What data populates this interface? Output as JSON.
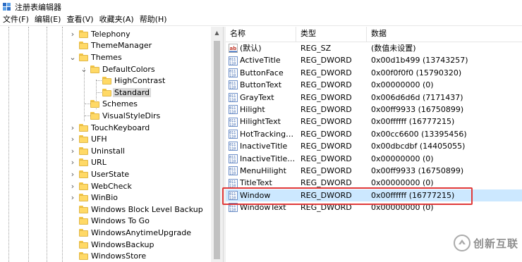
{
  "window": {
    "title": "注册表编辑器"
  },
  "menu": [
    "文件(F)",
    "编辑(E)",
    "查看(V)",
    "收藏夹(A)",
    "帮助(H)"
  ],
  "tree": {
    "items": [
      {
        "label": "Telephony",
        "expanded": false
      },
      {
        "label": "ThemeManager",
        "expanded": null
      },
      {
        "label": "Themes",
        "expanded": true
      },
      {
        "label": "DefaultColors",
        "expanded": true
      },
      {
        "label": "HighContrast",
        "expanded": null
      },
      {
        "label": "Standard",
        "expanded": null,
        "selected": true
      },
      {
        "label": "Schemes",
        "expanded": null
      },
      {
        "label": "VisualStyleDirs",
        "expanded": null
      },
      {
        "label": "TouchKeyboard",
        "expanded": false
      },
      {
        "label": "UFH",
        "expanded": false
      },
      {
        "label": "Uninstall",
        "expanded": false
      },
      {
        "label": "URL",
        "expanded": false
      },
      {
        "label": "UserState",
        "expanded": false
      },
      {
        "label": "WebCheck",
        "expanded": false
      },
      {
        "label": "WinBio",
        "expanded": false
      },
      {
        "label": "Windows Block Level Backup",
        "expanded": null
      },
      {
        "label": "Windows To Go",
        "expanded": null
      },
      {
        "label": "WindowsAnytimeUpgrade",
        "expanded": null
      },
      {
        "label": "WindowsBackup",
        "expanded": null
      },
      {
        "label": "WindowsStore",
        "expanded": null
      }
    ]
  },
  "list": {
    "headers": {
      "name": "名称",
      "type": "类型",
      "data": "数据"
    },
    "rows": [
      {
        "icon": "string-value-icon",
        "name": "(默认)",
        "type": "REG_SZ",
        "data": "(数值未设置)"
      },
      {
        "icon": "dword-value-icon",
        "name": "ActiveTitle",
        "type": "REG_DWORD",
        "data": "0x00d1b499 (13743257)"
      },
      {
        "icon": "dword-value-icon",
        "name": "ButtonFace",
        "type": "REG_DWORD",
        "data": "0x00f0f0f0 (15790320)"
      },
      {
        "icon": "dword-value-icon",
        "name": "ButtonText",
        "type": "REG_DWORD",
        "data": "0x00000000 (0)"
      },
      {
        "icon": "dword-value-icon",
        "name": "GrayText",
        "type": "REG_DWORD",
        "data": "0x006d6d6d (7171437)"
      },
      {
        "icon": "dword-value-icon",
        "name": "Hilight",
        "type": "REG_DWORD",
        "data": "0x00ff9933 (16750899)"
      },
      {
        "icon": "dword-value-icon",
        "name": "HilightText",
        "type": "REG_DWORD",
        "data": "0x00ffffff (16777215)"
      },
      {
        "icon": "dword-value-icon",
        "name": "HotTrackingC...",
        "type": "REG_DWORD",
        "data": "0x00cc6600 (13395456)"
      },
      {
        "icon": "dword-value-icon",
        "name": "InactiveTitle",
        "type": "REG_DWORD",
        "data": "0x00dbcdbf (14405055)"
      },
      {
        "icon": "dword-value-icon",
        "name": "InactiveTitleText",
        "type": "REG_DWORD",
        "data": "0x00000000 (0)"
      },
      {
        "icon": "dword-value-icon",
        "name": "MenuHilight",
        "type": "REG_DWORD",
        "data": "0x00ff9933 (16750899)"
      },
      {
        "icon": "dword-value-icon",
        "name": "TitleText",
        "type": "REG_DWORD",
        "data": "0x00000000 (0)"
      },
      {
        "icon": "dword-value-icon",
        "name": "Window",
        "type": "REG_DWORD",
        "data": "0x00ffffff (16777215)",
        "selected": true
      },
      {
        "icon": "dword-value-icon",
        "name": "WindowText",
        "type": "REG_DWORD",
        "data": "0x00000000 (0)"
      }
    ]
  },
  "colors": {
    "selection": "#cce8ff",
    "annotation": "#e03a3a",
    "folder": "#ffd966"
  },
  "watermark": {
    "text": "创新互联"
  }
}
